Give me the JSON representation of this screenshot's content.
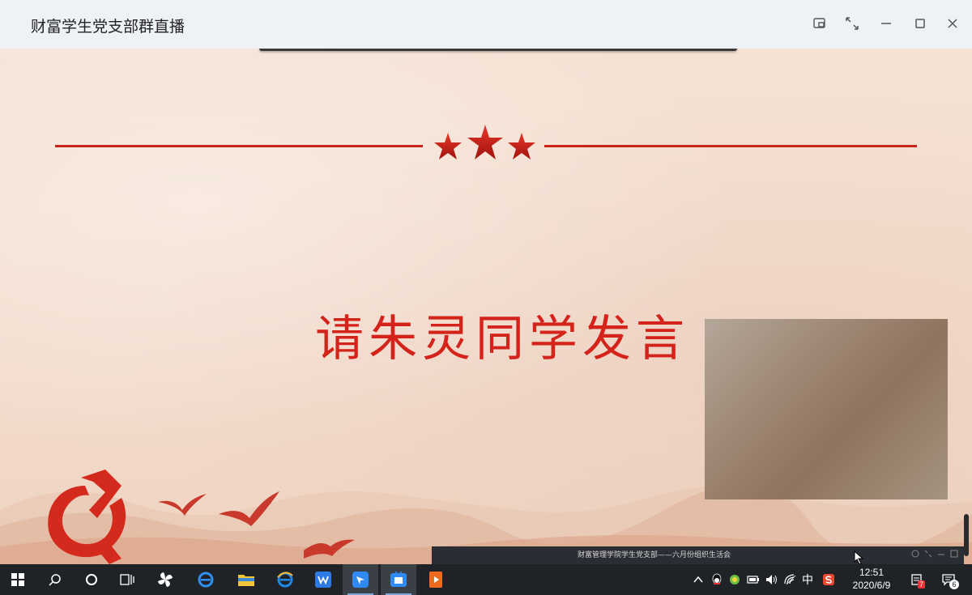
{
  "window": {
    "title": "财富学生党支部群直播"
  },
  "slide": {
    "headline": "请朱灵同学发言"
  },
  "mini_player": {
    "title": "财富管理学院学生党支部——六月份组织生活会"
  },
  "taskbar": {
    "ime_label": "中",
    "time": "12:51",
    "date": "2020/6/9",
    "notification_badge": "7",
    "action_center_badge": "6"
  },
  "colors": {
    "accent_red": "#d4231b",
    "taskbar_bg": "#1f2328",
    "titlebar_bg": "#eef1f6"
  }
}
